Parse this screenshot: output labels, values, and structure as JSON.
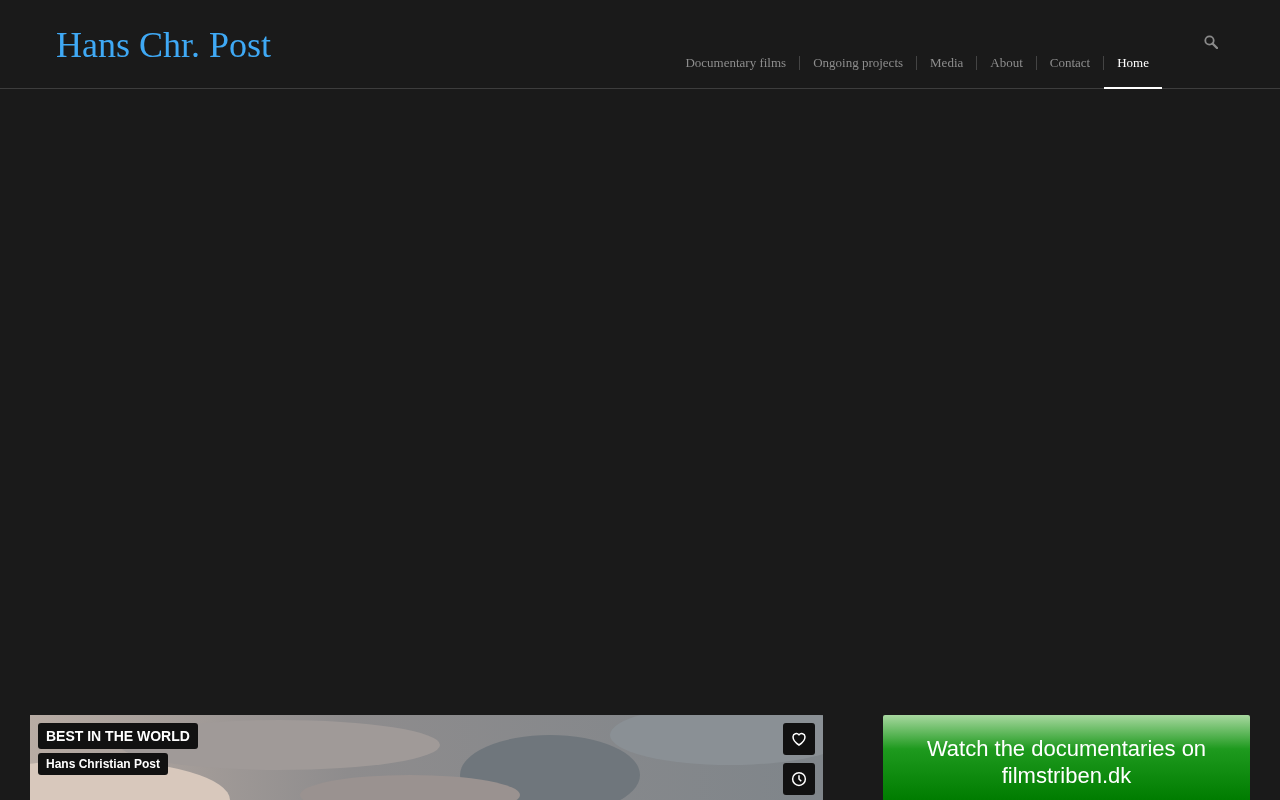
{
  "header": {
    "logo": "Hans Chr. Post",
    "nav": [
      {
        "label": "Documentary films",
        "selected": false
      },
      {
        "label": "Ongoing projects",
        "selected": false
      },
      {
        "label": "Media",
        "selected": false
      },
      {
        "label": "About",
        "selected": false
      },
      {
        "label": "Contact",
        "selected": false
      },
      {
        "label": "Home",
        "selected": true
      }
    ]
  },
  "featured": {
    "title": "BEST IN THE WORLD",
    "author": "Hans Christian Post"
  },
  "promo": {
    "label": "Watch the documentaries on filmstriben.dk"
  }
}
